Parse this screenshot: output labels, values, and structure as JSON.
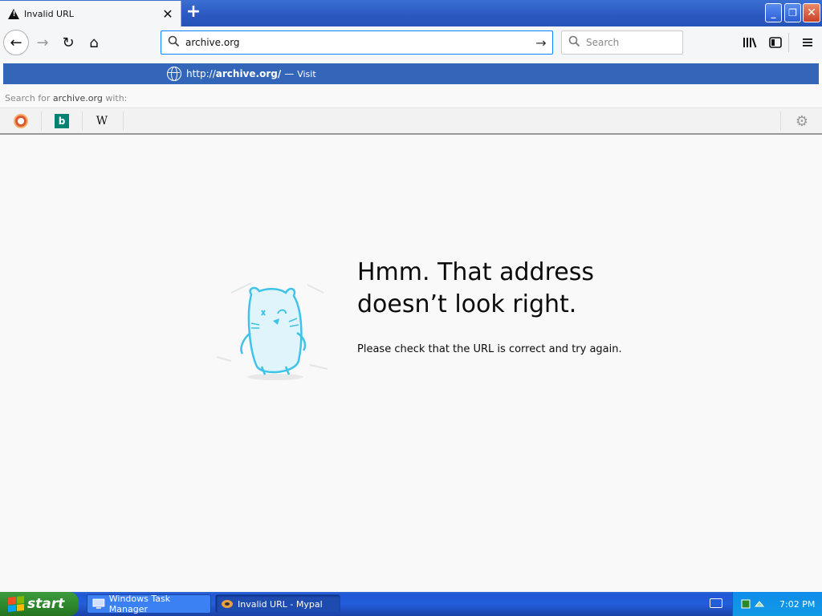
{
  "tab": {
    "title": "Invalid URL",
    "warning_glyph": "!",
    "close_glyph": "✕",
    "new_tab_glyph": "+"
  },
  "window": {
    "minimize": "_",
    "maximize": "❐",
    "close": "✕"
  },
  "nav": {
    "back": "←",
    "forward": "→",
    "reload": "↻",
    "home": "⌂"
  },
  "urlbar": {
    "value": "archive.org",
    "search_icon": "search-icon",
    "go_glyph": "→"
  },
  "search": {
    "placeholder": "Search"
  },
  "toolbar": {
    "library": "|||\\",
    "sidebar": "▯",
    "menu": "≡"
  },
  "suggestion": {
    "prefix": "http://",
    "url": "archive.org/",
    "dash": "—",
    "action": "Visit"
  },
  "search_for": {
    "prefix": "Search for ",
    "term": "archive.org",
    "suffix": " with:"
  },
  "engines": {
    "bing": "b",
    "wikipedia": "W",
    "settings": "⚙"
  },
  "error": {
    "heading_line1": "Hmm. That address",
    "heading_line2": "doesn’t look right.",
    "message": "Please check that the URL is correct and try again."
  },
  "taskbar": {
    "start": "start",
    "tasks": [
      {
        "label": "Windows Task Manager"
      },
      {
        "label": "Invalid URL - Mypal"
      }
    ],
    "clock": "7:02 PM"
  },
  "colors": {
    "accent": "#0a84ff",
    "suggest_bg": "#3366b8",
    "titlebar": "#2a58c0",
    "start_green": "#2f8a2f"
  }
}
